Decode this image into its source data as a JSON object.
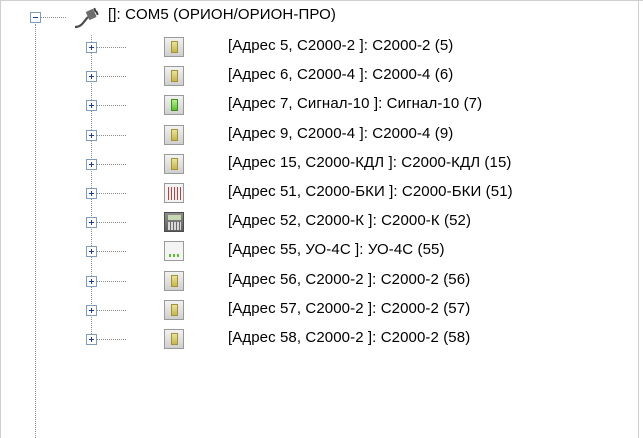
{
  "tree": {
    "root": {
      "label": "[]: COM5 (ОРИОН/ОРИОН-ПРО)",
      "expanded": true,
      "icon": "cable-plug-icon"
    },
    "children": [
      {
        "label": "[Адрес 5, С2000-2 ]: С2000-2 (5)",
        "icon": "device-c2000-2-icon"
      },
      {
        "label": "[Адрес 6, С2000-4 ]: С2000-4 (6)",
        "icon": "device-c2000-4-icon"
      },
      {
        "label": "[Адрес 7, Сигнал-10 ]: Сигнал-10 (7)",
        "icon": "device-signal-10-icon"
      },
      {
        "label": "[Адрес 9, С2000-4 ]: С2000-4 (9)",
        "icon": "device-c2000-4-icon"
      },
      {
        "label": "[Адрес 15, С2000-КДЛ ]: С2000-КДЛ (15)",
        "icon": "device-c2000-kdl-icon"
      },
      {
        "label": "[Адрес 51, С2000-БКИ ]: С2000-БКИ (51)",
        "icon": "device-c2000-bki-icon"
      },
      {
        "label": "[Адрес 52, С2000-К ]: С2000-К (52)",
        "icon": "device-c2000-k-icon"
      },
      {
        "label": "[Адрес 55, УО-4С ]: УО-4С (55)",
        "icon": "device-uo-4c-icon"
      },
      {
        "label": "[Адрес 56, С2000-2 ]: С2000-2 (56)",
        "icon": "device-c2000-2-icon"
      },
      {
        "label": "[Адрес 57, С2000-2 ]: С2000-2 (57)",
        "icon": "device-c2000-2-icon"
      },
      {
        "label": "[Адрес 58, С2000-2 ]: С2000-2 (58)",
        "icon": "device-c2000-2-icon"
      }
    ]
  }
}
